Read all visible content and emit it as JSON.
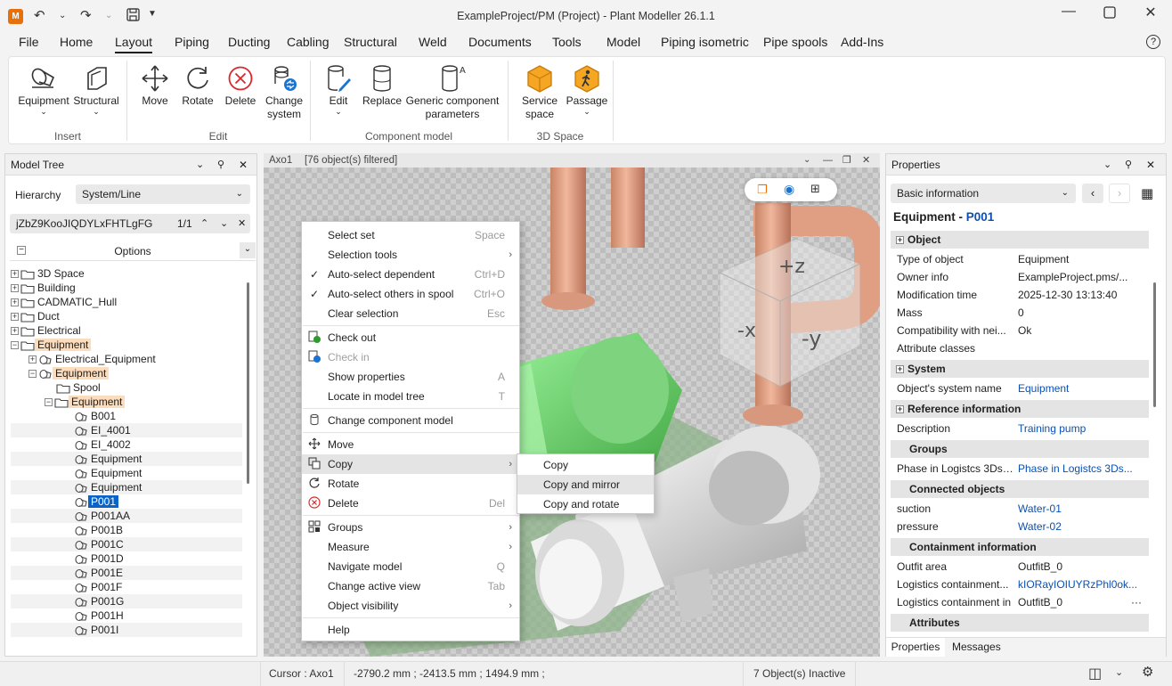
{
  "window": {
    "title": "ExampleProject/PM (Project) - Plant Modeller 26.1.1",
    "app_icon": "M"
  },
  "menu": [
    "File",
    "Home",
    "Layout",
    "Piping",
    "Ducting",
    "Cabling",
    "Structural",
    "Weld",
    "Documents",
    "Tools",
    "Model",
    "Piping isometric",
    "Pipe spools",
    "Add-Ins"
  ],
  "menu_active": "Layout",
  "ribbon": {
    "buttons": [
      {
        "label": "Equipment",
        "icon": "equipment-icon"
      },
      {
        "label": "Structural",
        "icon": "structural-icon"
      },
      {
        "label": "Move",
        "icon": "move-icon"
      },
      {
        "label": "Rotate",
        "icon": "rotate-icon"
      },
      {
        "label": "Delete",
        "icon": "delete-icon"
      },
      {
        "label": "Change system",
        "icon": "change-system-icon"
      },
      {
        "label": "Edit",
        "icon": "edit-icon"
      },
      {
        "label": "Replace",
        "icon": "replace-icon"
      },
      {
        "label": "Generic component parameters",
        "icon": "generic-component-icon"
      },
      {
        "label": "Service space",
        "icon": "service-space-icon"
      },
      {
        "label": "Passage",
        "icon": "passage-icon"
      }
    ],
    "groups": [
      "Insert",
      "Edit",
      "Component model",
      "3D Space"
    ]
  },
  "model_tree": {
    "title": "Model Tree",
    "hierarchy_label": "Hierarchy",
    "hierarchy_value": "System/Line",
    "search_value": "jZbZ9KooJIQDYLxFHTLgFG",
    "search_count": "1/1",
    "options_label": "Options",
    "rows": [
      {
        "label": "3D Space",
        "depth": 0,
        "exp": "+"
      },
      {
        "label": "Building",
        "depth": 0,
        "exp": "+"
      },
      {
        "label": "CADMATIC_Hull",
        "depth": 0,
        "exp": "+"
      },
      {
        "label": "Duct",
        "depth": 0,
        "exp": "+"
      },
      {
        "label": "Electrical",
        "depth": 0,
        "exp": "+"
      },
      {
        "label": "Equipment",
        "depth": 0,
        "exp": "-",
        "hl": true
      },
      {
        "label": "Electrical_Equipment",
        "depth": 1,
        "exp": "+",
        "eq": true
      },
      {
        "label": "Equipment",
        "depth": 1,
        "exp": "-",
        "eq": true,
        "hl": true
      },
      {
        "label": "Spool",
        "depth": 2,
        "exp": ""
      },
      {
        "label": "Equipment",
        "depth": 2,
        "exp": "-",
        "hl": true
      },
      {
        "label": "B001",
        "depth": 3,
        "eq": true
      },
      {
        "label": "EI_4001",
        "depth": 3,
        "eq": true
      },
      {
        "label": "EI_4002",
        "depth": 3,
        "eq": true
      },
      {
        "label": "Equipment",
        "depth": 3,
        "eq": true
      },
      {
        "label": "Equipment",
        "depth": 3,
        "eq": true
      },
      {
        "label": "Equipment",
        "depth": 3,
        "eq": true
      },
      {
        "label": "P001",
        "depth": 3,
        "eq": true,
        "sel": true
      },
      {
        "label": "P001AA",
        "depth": 3,
        "eq": true
      },
      {
        "label": "P001B",
        "depth": 3,
        "eq": true
      },
      {
        "label": "P001C",
        "depth": 3,
        "eq": true
      },
      {
        "label": "P001D",
        "depth": 3,
        "eq": true
      },
      {
        "label": "P001E",
        "depth": 3,
        "eq": true
      },
      {
        "label": "P001F",
        "depth": 3,
        "eq": true
      },
      {
        "label": "P001G",
        "depth": 3,
        "eq": true
      },
      {
        "label": "P001H",
        "depth": 3,
        "eq": true
      },
      {
        "label": "P001I",
        "depth": 3,
        "eq": true
      }
    ]
  },
  "viewport": {
    "name": "Axo1",
    "filter_text": "[76 object(s) filtered]",
    "cube_labels": [
      "+z",
      "-x",
      "-y"
    ]
  },
  "context_menu": [
    {
      "label": "Select set",
      "shortcut": "Space"
    },
    {
      "label": "Selection tools",
      "arrow": true
    },
    {
      "label": "Auto-select dependent",
      "shortcut": "Ctrl+D",
      "check": true
    },
    {
      "label": "Auto-select others in spool",
      "shortcut": "Ctrl+O",
      "check": true
    },
    {
      "label": "Clear selection",
      "shortcut": "Esc"
    },
    {
      "sep": true
    },
    {
      "label": "Check out",
      "icon": "check-out-icon"
    },
    {
      "label": "Check in",
      "icon": "check-in-icon",
      "disabled": true
    },
    {
      "label": "Show properties",
      "shortcut": "A"
    },
    {
      "label": "Locate in model tree",
      "shortcut": "T"
    },
    {
      "sep": true
    },
    {
      "label": "Change component model",
      "icon": "component-model-icon"
    },
    {
      "sep": true
    },
    {
      "label": "Move",
      "icon": "move-icon"
    },
    {
      "label": "Copy",
      "icon": "copy-icon",
      "arrow": true,
      "hover": true
    },
    {
      "label": "Rotate",
      "icon": "rotate-icon"
    },
    {
      "label": "Delete",
      "icon": "delete-icon",
      "shortcut": "Del"
    },
    {
      "sep": true
    },
    {
      "label": "Groups",
      "icon": "groups-icon",
      "arrow": true
    },
    {
      "label": "Measure",
      "arrow": true
    },
    {
      "label": "Navigate model",
      "shortcut": "Q"
    },
    {
      "label": "Change active view",
      "shortcut": "Tab"
    },
    {
      "label": "Object visibility",
      "arrow": true
    },
    {
      "sep": true
    },
    {
      "label": "Help"
    }
  ],
  "submenu": [
    "Copy",
    "Copy and mirror",
    "Copy and rotate"
  ],
  "submenu_hover": "Copy and mirror",
  "properties": {
    "title": "Properties",
    "dropdown_value": "Basic information",
    "heading_prefix": "Equipment",
    "heading_value": "P001",
    "sections": [
      {
        "title": "Object",
        "exp": "+",
        "rows": [
          {
            "k": "Type of object",
            "v": "Equipment"
          },
          {
            "k": "Owner info",
            "v": "ExampleProject.pms/..."
          },
          {
            "k": "Modification time",
            "v": "2025-12-30 13:13:40"
          },
          {
            "k": "Mass",
            "v": "0"
          },
          {
            "k": "Compatibility with nei...",
            "v": "Ok"
          },
          {
            "k": "Attribute classes",
            "v": ""
          }
        ]
      },
      {
        "title": "System",
        "exp": "+",
        "rows": [
          {
            "k": "Object's system name",
            "v": "Equipment",
            "link": true
          }
        ]
      },
      {
        "title": "Reference information",
        "exp": "+",
        "rows": [
          {
            "k": "Description",
            "v": "Training pump",
            "link": true
          }
        ]
      },
      {
        "title": "Groups",
        "rows": [
          {
            "k": "Phase in Logistcs 3Dsp...",
            "v": "Phase in Logistcs 3Ds...",
            "link": true
          }
        ]
      },
      {
        "title": "Connected objects",
        "rows": [
          {
            "k": "suction",
            "v": "Water-01",
            "link": true
          },
          {
            "k": "pressure",
            "v": "Water-02",
            "link": true
          }
        ]
      },
      {
        "title": "Containment information",
        "rows": [
          {
            "k": "Outfit area",
            "v": "OutfitB_0"
          },
          {
            "k": "Logistics containment...",
            "v": "kIORayIOIUYRzPhl0ok...",
            "link": true
          },
          {
            "k": "Logistics containment in",
            "v": "OutfitB_0",
            "more": "···"
          }
        ]
      },
      {
        "title": "Attributes",
        "rows": []
      }
    ],
    "tabs": [
      "Properties",
      "Messages"
    ]
  },
  "status": {
    "cursor": "Cursor : Axo1",
    "coords": "-2790.2 mm ; -2413.5 mm ; 1494.9 mm ;",
    "inactive": "7 Object(s) Inactive"
  },
  "colors": {
    "accent": "#0a64c8",
    "tree_highlight": "#fbdcbc",
    "link": "#0a50b4",
    "app_icon": "#e8700b"
  }
}
